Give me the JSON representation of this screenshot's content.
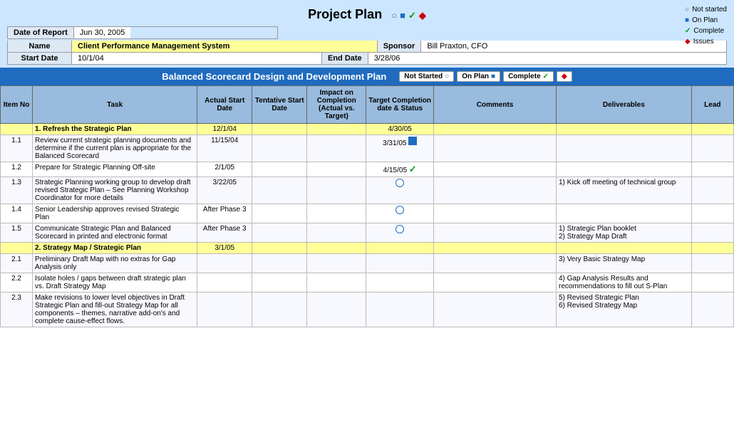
{
  "header": {
    "title": "Project Plan",
    "legend": [
      {
        "symbol": "○",
        "color": "#1e6bbf",
        "label": "Not started"
      },
      {
        "symbol": "■",
        "color": "#1e6bbf",
        "label": "On Plan"
      },
      {
        "symbol": "✓",
        "color": "#009900",
        "label": "Complete"
      },
      {
        "symbol": "◆",
        "color": "#cc0000",
        "label": "Issues"
      }
    ]
  },
  "meta": {
    "date_label": "Date of Report",
    "date_value": "Jun 30, 2005",
    "name_label": "Name",
    "name_value": "Client Performance Management System",
    "sponsor_label": "Sponsor",
    "sponsor_value": "Bill Praxton, CFO",
    "start_label": "Start Date",
    "start_value": "10/1/04",
    "end_label": "End Date",
    "end_value": "3/28/06"
  },
  "section_header": "Balanced Scorecard Design and Development Plan",
  "badges": [
    {
      "label": "Not Started ○"
    },
    {
      "label": "On Plan ■"
    },
    {
      "label": "Complete ✓"
    },
    {
      "label": "◆"
    }
  ],
  "columns": [
    "Item No",
    "Task",
    "Actual Start Date",
    "Tentative Start Date",
    "Impact on Completion (Actual vs. Target)",
    "Target Completion date & Status",
    "Comments",
    "Deliverables",
    "Lead"
  ],
  "rows": [
    {
      "type": "section",
      "item": "",
      "task": "1. Refresh the Strategic Plan",
      "actual_start": "12/1/04",
      "tentative_start": "",
      "impact": "",
      "target": "4/30/05",
      "comments": "",
      "deliverables": "",
      "lead": ""
    },
    {
      "type": "normal",
      "item": "1.1",
      "task": "Review current strategic planning documents and determine if the current plan is appropriate for the Balanced Scorecard",
      "actual_start": "11/15/04",
      "tentative_start": "",
      "impact": "",
      "target": "3/31/05",
      "status_icon": "square",
      "comments": "",
      "deliverables": "",
      "lead": ""
    },
    {
      "type": "normal",
      "item": "1.2",
      "task": "Prepare for Strategic Planning Off-site",
      "actual_start": "2/1/05",
      "tentative_start": "",
      "impact": "",
      "target": "4/15/05",
      "status_icon": "check",
      "comments": "",
      "deliverables": "",
      "lead": ""
    },
    {
      "type": "normal",
      "item": "1.3",
      "task": "Strategic Planning working group to develop draft revised Strategic Plan – See Planning Workshop Coordinator for more details",
      "actual_start": "3/22/05",
      "tentative_start": "",
      "impact": "",
      "target": "",
      "status_icon": "circle",
      "comments": "",
      "deliverables": "1) Kick off meeting of technical group",
      "lead": ""
    },
    {
      "type": "normal",
      "item": "1.4",
      "task": "Senior Leadership approves revised Strategic Plan",
      "actual_start": "After Phase 3",
      "tentative_start": "",
      "impact": "",
      "target": "",
      "status_icon": "circle",
      "comments": "",
      "deliverables": "",
      "lead": ""
    },
    {
      "type": "normal",
      "item": "1.5",
      "task": "Communicate Strategic Plan and Balanced Scorecard in printed and electronic format",
      "actual_start": "After Phase 3",
      "tentative_start": "",
      "impact": "",
      "target": "",
      "status_icon": "circle",
      "comments": "",
      "deliverables": "1) Strategic Plan booklet\n2) Strategy Map Draft",
      "lead": ""
    },
    {
      "type": "section",
      "item": "",
      "task": "2. Strategy Map / Strategic Plan",
      "actual_start": "3/1/05",
      "tentative_start": "",
      "impact": "",
      "target": "",
      "comments": "",
      "deliverables": "",
      "lead": ""
    },
    {
      "type": "normal",
      "item": "2.1",
      "task": "Preliminary Draft Map with no extras for Gap Analysis only",
      "actual_start": "",
      "tentative_start": "",
      "impact": "",
      "target": "",
      "status_icon": "",
      "comments": "",
      "deliverables": "3) Very Basic Strategy Map",
      "lead": ""
    },
    {
      "type": "normal",
      "item": "2.2",
      "task": "Isolate holes / gaps between draft strategic plan vs. Draft Strategy Map",
      "actual_start": "",
      "tentative_start": "",
      "impact": "",
      "target": "",
      "status_icon": "",
      "comments": "",
      "deliverables": "4) Gap Analysis Results and recommendations to fill out S-Plan",
      "lead": ""
    },
    {
      "type": "normal",
      "item": "2.3",
      "task": "Make revisions to lower level objectives in Draft Strategic Plan and fill-out Strategy Map for all components – themes, narrative add-on's and complete cause-effect flows.",
      "actual_start": "",
      "tentative_start": "",
      "impact": "",
      "target": "",
      "status_icon": "",
      "comments": "",
      "deliverables": "5) Revised Strategic Plan\n6) Revised Strategy Map",
      "lead": ""
    }
  ]
}
